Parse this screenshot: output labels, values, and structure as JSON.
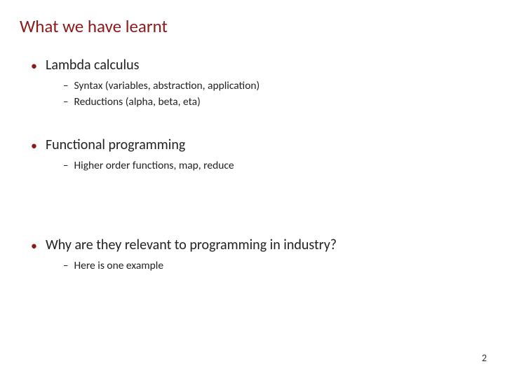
{
  "title": "What we have learnt",
  "sections": [
    {
      "heading": "Lambda calculus",
      "items": [
        "Syntax (variables, abstraction, application)",
        "Reductions (alpha, beta, eta)"
      ]
    },
    {
      "heading": "Functional programming",
      "items": [
        "Higher order functions, map, reduce"
      ]
    },
    {
      "heading": "Why are they relevant to programming in industry?",
      "items": [
        "Here is one example"
      ]
    }
  ],
  "page_number": "2"
}
